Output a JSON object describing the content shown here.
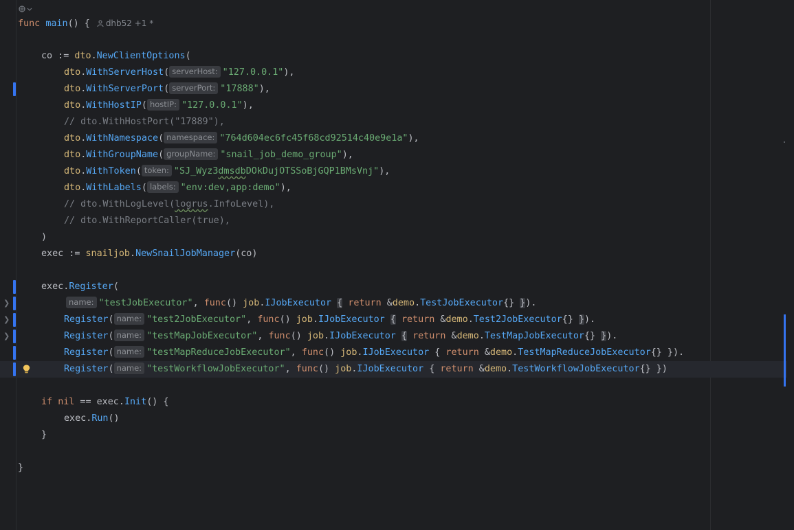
{
  "editor": {
    "author_label": "dhb52 +1 *",
    "lines": {
      "func_kw": "func",
      "func_name": "main",
      "func_rest": "() {",
      "co_var": "co := ",
      "dto": "dto",
      "new_client_options": "NewClientOptions",
      "with_server_host": "WithServerHost",
      "hint_server_host": "serverHost:",
      "val_server_host": "\"127.0.0.1\"",
      "with_server_port": "WithServerPort",
      "hint_server_port": "serverPort:",
      "val_server_port": "\"17888\"",
      "with_host_ip": "WithHostIP",
      "hint_host_ip": "hostIP:",
      "val_host_ip": "\"127.0.0.1\"",
      "comment_host_port": "// dto.WithHostPort(\"17889\"),",
      "with_namespace": "WithNamespace",
      "hint_namespace": "namespace:",
      "val_namespace": "\"764d604ec6fc45f68cd92514c40e9e1a\"",
      "with_group_name": "WithGroupName",
      "hint_group_name": "groupName:",
      "val_group_name": "\"snail_job_demo_group\"",
      "with_token": "WithToken",
      "hint_token": "token:",
      "val_token_a": "\"SJ_Wyz3",
      "val_token_b": "dmsdb",
      "val_token_c": "DOkDujOTSSoBjGQP1BMsVnj\"",
      "with_labels": "WithLabels",
      "hint_labels": "labels:",
      "val_labels": "\"env:dev,app:demo\"",
      "comment_log_a": "// dto.WithLogLevel(",
      "comment_log_b": "logrus",
      "comment_log_c": ".InfoLevel),",
      "comment_report": "// dto.WithReportCaller(true),",
      "close_paren": ")",
      "exec_var": "exec := ",
      "snailjob": "snailjob",
      "new_manager": "NewSnailJobManager",
      "new_manager_args": "(co)",
      "exec": "exec",
      "register": "Register",
      "hint_name": "name:",
      "job": "job",
      "ijob": "IJobExecutor",
      "return_kw": "return",
      "demo": "demo",
      "func_kw2": "func",
      "val_test": "\"testJobExecutor\"",
      "t_test": "TestJobExecutor",
      "val_test2": "\"test2JobExecutor\"",
      "t_test2": "Test2JobExecutor",
      "val_map": "\"testMapJobExecutor\"",
      "t_map": "TestMapJobExecutor",
      "val_mapreduce": "\"testMapReduceJobExecutor\"",
      "t_mapreduce": "TestMapReduceJobExecutor",
      "val_workflow": "\"testWorkflowJobExecutor\"",
      "t_workflow": "TestWorkflowJobExecutor",
      "if_kw": "if",
      "nil_kw": "nil",
      "init": "Init",
      "run": "Run",
      "close_brace": "}"
    }
  },
  "colors": {
    "background": "#1e1f22",
    "keyword": "#cf8e6d",
    "function": "#56a8f5",
    "package": "#d5b778",
    "string": "#6aab73",
    "comment": "#7a7e85",
    "change_marker": "#3574f0"
  }
}
